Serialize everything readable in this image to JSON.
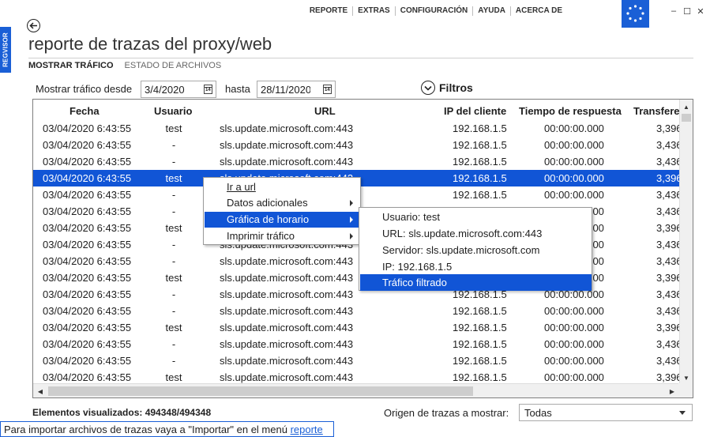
{
  "app": {
    "side_tab": "REGVISOR",
    "title": "reporte de trazas del proxy/web",
    "menu": [
      "REPORTE",
      "EXTRAS",
      "CONFIGURACIÓN",
      "AYUDA",
      "ACERCA DE"
    ],
    "window_controls": [
      "–",
      "☐",
      "✕"
    ]
  },
  "tabs": [
    {
      "label": "MOSTRAR TRÁFICO",
      "active": true
    },
    {
      "label": "ESTADO DE ARCHIVOS",
      "active": false
    }
  ],
  "filters": {
    "from_label": "Mostrar tráfico desde",
    "from_value": "3/4/2020",
    "to_label": "hasta",
    "to_value": "28/11/2020",
    "filters_label": "Filtros"
  },
  "grid": {
    "columns": [
      "Fecha",
      "Usuario",
      "URL",
      "IP del cliente",
      "Tiempo de respuesta",
      "Transfere"
    ],
    "rows": [
      {
        "fecha": "03/04/2020 6:43:55",
        "usuario": "test",
        "url": "sls.update.microsoft.com:443",
        "ip": "192.168.1.5",
        "tiempo": "00:00:00.000",
        "transfer": "3,396",
        "selected": false
      },
      {
        "fecha": "03/04/2020 6:43:55",
        "usuario": "-",
        "url": "sls.update.microsoft.com:443",
        "ip": "192.168.1.5",
        "tiempo": "00:00:00.000",
        "transfer": "3,436",
        "selected": false
      },
      {
        "fecha": "03/04/2020 6:43:55",
        "usuario": "-",
        "url": "sls.update.microsoft.com:443",
        "ip": "192.168.1.5",
        "tiempo": "00:00:00.000",
        "transfer": "3,436",
        "selected": false
      },
      {
        "fecha": "03/04/2020 6:43:55",
        "usuario": "test",
        "url": "sls.update.microsoft.com:443",
        "ip": "192.168.1.5",
        "tiempo": "00:00:00.000",
        "transfer": "3,396",
        "selected": true
      },
      {
        "fecha": "03/04/2020 6:43:55",
        "usuario": "-",
        "url": "sls.update.microsoft.com:443",
        "ip": "192.168.1.5",
        "tiempo": "00:00:00.000",
        "transfer": "3,436",
        "selected": false
      },
      {
        "fecha": "03/04/2020 6:43:55",
        "usuario": "-",
        "url": "sls.update.microsoft.com:443",
        "ip": "192.168.1.5",
        "tiempo": "00:00:00.000",
        "transfer": "3,436",
        "selected": false
      },
      {
        "fecha": "03/04/2020 6:43:55",
        "usuario": "test",
        "url": "sls.update.microsoft.com:443",
        "ip": "192.168.1.5",
        "tiempo": "00:00:00.000",
        "transfer": "3,396",
        "selected": false
      },
      {
        "fecha": "03/04/2020 6:43:55",
        "usuario": "-",
        "url": "sls.update.microsoft.com:443",
        "ip": "192.168.1.5",
        "tiempo": "00:00:00.000",
        "transfer": "3,436",
        "selected": false
      },
      {
        "fecha": "03/04/2020 6:43:55",
        "usuario": "-",
        "url": "sls.update.microsoft.com:443",
        "ip": "192.168.1.5",
        "tiempo": "00:00:00.000",
        "transfer": "3,436",
        "selected": false
      },
      {
        "fecha": "03/04/2020 6:43:55",
        "usuario": "test",
        "url": "sls.update.microsoft.com:443",
        "ip": "192.168.1.5",
        "tiempo": "00:00:00.000",
        "transfer": "3,396",
        "selected": false
      },
      {
        "fecha": "03/04/2020 6:43:55",
        "usuario": "-",
        "url": "sls.update.microsoft.com:443",
        "ip": "192.168.1.5",
        "tiempo": "00:00:00.000",
        "transfer": "3,436",
        "selected": false
      },
      {
        "fecha": "03/04/2020 6:43:55",
        "usuario": "-",
        "url": "sls.update.microsoft.com:443",
        "ip": "192.168.1.5",
        "tiempo": "00:00:00.000",
        "transfer": "3,436",
        "selected": false
      },
      {
        "fecha": "03/04/2020 6:43:55",
        "usuario": "test",
        "url": "sls.update.microsoft.com:443",
        "ip": "192.168.1.5",
        "tiempo": "00:00:00.000",
        "transfer": "3,396",
        "selected": false
      },
      {
        "fecha": "03/04/2020 6:43:55",
        "usuario": "-",
        "url": "sls.update.microsoft.com:443",
        "ip": "192.168.1.5",
        "tiempo": "00:00:00.000",
        "transfer": "3,436",
        "selected": false
      },
      {
        "fecha": "03/04/2020 6:43:55",
        "usuario": "-",
        "url": "sls.update.microsoft.com:443",
        "ip": "192.168.1.5",
        "tiempo": "00:00:00.000",
        "transfer": "3,436",
        "selected": false
      },
      {
        "fecha": "03/04/2020 6:43:55",
        "usuario": "test",
        "url": "sls.update.microsoft.com:443",
        "ip": "192.168.1.5",
        "tiempo": "00:00:00.000",
        "transfer": "3,396",
        "selected": false
      }
    ]
  },
  "context_menu": {
    "items": [
      {
        "label": "Ir a url",
        "underline": true,
        "has_submenu": false,
        "highlighted": false
      },
      {
        "label": "Datos adicionales",
        "underline": false,
        "has_submenu": true,
        "highlighted": false
      },
      {
        "label": "Gráfica de horario",
        "underline": false,
        "has_submenu": true,
        "highlighted": true
      },
      {
        "label": "Imprimir tráfico",
        "underline": false,
        "has_submenu": true,
        "highlighted": false
      }
    ]
  },
  "submenu": {
    "items": [
      {
        "label": "Usuario:  test",
        "highlighted": false
      },
      {
        "label": "URL:  sls.update.microsoft.com:443",
        "highlighted": false
      },
      {
        "label": "Servidor:  sls.update.microsoft.com",
        "highlighted": false
      },
      {
        "label": "IP:  192.168.1.5",
        "highlighted": false
      },
      {
        "label": "Tráfico filtrado",
        "highlighted": true
      }
    ]
  },
  "footer": {
    "counter": "Elementos visualizados: 494348/494348",
    "origin_label": "Origen de trazas a mostrar:",
    "origin_value": "Todas",
    "status_prefix": "Para importar archivos de trazas vaya a \"Importar\" en el menú ",
    "status_link": "reporte"
  },
  "colors": {
    "accent": "#1a5fd6",
    "selection": "#1155d6"
  },
  "icons": [
    "back-arrow-icon",
    "calendar-icon",
    "chevron-down-icon",
    "app-logo-icon",
    "scroll-up-icon",
    "scroll-down-icon",
    "scroll-left-icon",
    "scroll-right-icon",
    "submenu-arrow-icon",
    "dropdown-arrow-icon"
  ]
}
